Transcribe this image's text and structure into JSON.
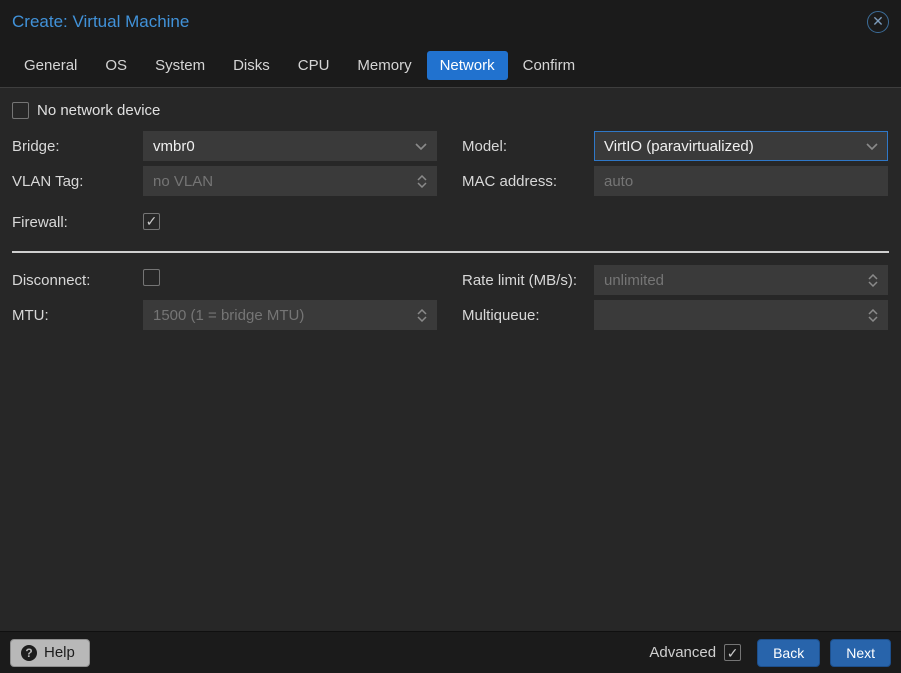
{
  "window": {
    "title": "Create: Virtual Machine"
  },
  "tabs": [
    {
      "label": "General",
      "active": false
    },
    {
      "label": "OS",
      "active": false
    },
    {
      "label": "System",
      "active": false
    },
    {
      "label": "Disks",
      "active": false
    },
    {
      "label": "CPU",
      "active": false
    },
    {
      "label": "Memory",
      "active": false
    },
    {
      "label": "Network",
      "active": true
    },
    {
      "label": "Confirm",
      "active": false
    }
  ],
  "form": {
    "no_network_device": {
      "label": "No network device",
      "checked": false
    },
    "bridge": {
      "label": "Bridge:",
      "value": "vmbr0"
    },
    "model": {
      "label": "Model:",
      "value": "VirtIO (paravirtualized)",
      "focused": true
    },
    "vlan_tag": {
      "label": "VLAN Tag:",
      "placeholder": "no VLAN"
    },
    "mac_address": {
      "label": "MAC address:",
      "placeholder": "auto"
    },
    "firewall": {
      "label": "Firewall:",
      "checked": true
    },
    "disconnect": {
      "label": "Disconnect:",
      "checked": false
    },
    "rate_limit": {
      "label": "Rate limit (MB/s):",
      "placeholder": "unlimited"
    },
    "mtu": {
      "label": "MTU:",
      "placeholder": "1500 (1 = bridge MTU)"
    },
    "multiqueue": {
      "label": "Multiqueue:",
      "placeholder": ""
    }
  },
  "footer": {
    "help_label": "Help",
    "help_icon_glyph": "?",
    "advanced": {
      "label": "Advanced",
      "checked": true
    },
    "back_label": "Back",
    "next_label": "Next"
  },
  "colors": {
    "title_blue": "#4192d9",
    "active_tab_blue": "#2172cf",
    "button_blue": "#2864ab",
    "focus_border_blue": "#2f78c8",
    "body_bg": "#272727",
    "bar_bg": "#1b1b1b",
    "field_bg": "#3a3a3a"
  }
}
